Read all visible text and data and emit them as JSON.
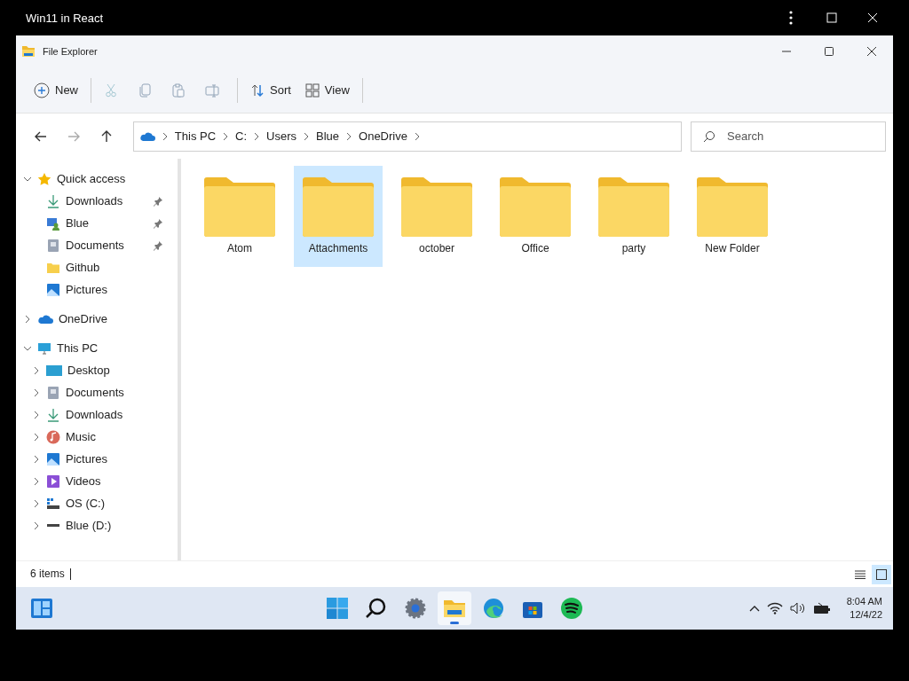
{
  "host": {
    "title": "Win11 in React"
  },
  "explorer": {
    "title": "File Explorer",
    "toolbar": [
      [
        {
          "kind": "new",
          "label": "New",
          "disabled": false
        }
      ],
      [
        {
          "kind": "cut",
          "disabled": true
        },
        {
          "kind": "copy",
          "disabled": true
        },
        {
          "kind": "paste",
          "disabled": true
        },
        {
          "kind": "rename",
          "disabled": true
        }
      ],
      [
        {
          "kind": "sort",
          "label": "Sort",
          "disabled": false
        },
        {
          "kind": "view",
          "label": "View",
          "disabled": false
        }
      ]
    ],
    "nav": [
      {
        "kind": "back",
        "disabled": false
      },
      {
        "kind": "forward",
        "disabled": true
      },
      {
        "kind": "up",
        "disabled": false
      }
    ],
    "breadcrumb": [
      "This PC",
      "C:",
      "Users",
      "Blue",
      "OneDrive"
    ],
    "search": {
      "placeholder": "Search"
    },
    "sidebar": [
      {
        "label": "Quick access",
        "kind": "star",
        "expanded": true,
        "children": [
          {
            "label": "Downloads",
            "kind": "download",
            "pinned": true
          },
          {
            "label": "Blue",
            "kind": "user",
            "pinned": true
          },
          {
            "label": "Documents",
            "kind": "document",
            "pinned": true
          },
          {
            "label": "Github",
            "kind": "folder",
            "pinned": false
          },
          {
            "label": "Pictures",
            "kind": "picture-folder",
            "pinned": false
          }
        ]
      },
      {
        "label": "OneDrive",
        "kind": "cloud",
        "expanded": false
      },
      {
        "label": "This PC",
        "kind": "monitor",
        "expanded": true,
        "children": [
          {
            "label": "Desktop",
            "kind": "desktop",
            "expanded": false
          },
          {
            "label": "Documents",
            "kind": "document",
            "expanded": false
          },
          {
            "label": "Downloads",
            "kind": "download",
            "expanded": false
          },
          {
            "label": "Music",
            "kind": "music",
            "expanded": false
          },
          {
            "label": "Pictures",
            "kind": "picture-folder",
            "expanded": false
          },
          {
            "label": "Videos",
            "kind": "video",
            "expanded": false
          },
          {
            "label": "OS (C:)",
            "kind": "os-drive",
            "expanded": false
          },
          {
            "label": "Blue (D:)",
            "kind": "drive",
            "expanded": false
          }
        ]
      }
    ],
    "files": [
      {
        "name": "Atom",
        "selected": false
      },
      {
        "name": "Attachments",
        "selected": true
      },
      {
        "name": "october",
        "selected": false
      },
      {
        "name": "Office",
        "selected": false
      },
      {
        "name": "party",
        "selected": false
      },
      {
        "name": "New Folder",
        "selected": false
      }
    ],
    "status": {
      "count": "6 items",
      "views": [
        {
          "kind": "details",
          "selected": false
        },
        {
          "kind": "tiles",
          "selected": true
        }
      ]
    }
  },
  "taskbar": {
    "apps": [
      {
        "kind": "start",
        "active": false
      },
      {
        "kind": "search",
        "active": false
      },
      {
        "kind": "settings",
        "active": false
      },
      {
        "kind": "explorer",
        "active": true
      },
      {
        "kind": "edge",
        "active": false
      },
      {
        "kind": "store",
        "active": false
      },
      {
        "kind": "spotify",
        "active": false
      }
    ],
    "time": "8:04 AM",
    "date": "12/4/22"
  }
}
